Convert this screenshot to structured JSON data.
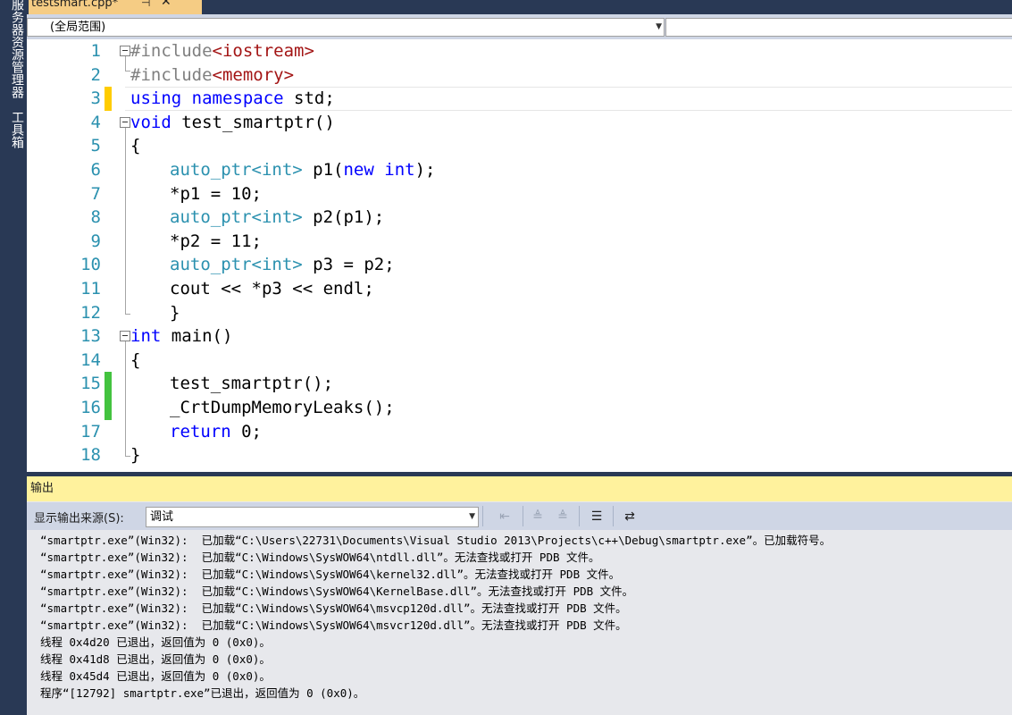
{
  "sidebar": {
    "tabs": [
      {
        "label": "服务器资源管理器"
      },
      {
        "label": "工具箱"
      }
    ]
  },
  "tab": {
    "title": "testsmart.cpp*",
    "pin_glyph": "⊣",
    "close_glyph": "✕"
  },
  "navbar": {
    "scope": "(全局范围)",
    "right": ""
  },
  "editor": {
    "lines": [
      {
        "n": "1"
      },
      {
        "n": "2"
      },
      {
        "n": "3"
      },
      {
        "n": "4"
      },
      {
        "n": "5"
      },
      {
        "n": "6"
      },
      {
        "n": "7"
      },
      {
        "n": "8"
      },
      {
        "n": "9"
      },
      {
        "n": "10"
      },
      {
        "n": "11"
      },
      {
        "n": "12"
      },
      {
        "n": "13"
      },
      {
        "n": "14"
      },
      {
        "n": "15"
      },
      {
        "n": "16"
      },
      {
        "n": "17"
      },
      {
        "n": "18"
      }
    ],
    "tokens": {
      "include": "#include",
      "iostream": "<iostream>",
      "memory": "<memory>",
      "using": "using",
      "namespace": "namespace",
      "std": " std;",
      "void": "void",
      "test_fn": " test_smartptr()",
      "lbrace": "{",
      "rbrace": "}",
      "auto_ptr": "auto_ptr",
      "int_tmpl": "<int>",
      "p1_decl": " p1(",
      "new": "new",
      "int": "int",
      "close_paren_semi": ");",
      "p1_assign": "*p1 = 10;",
      "p2_decl": " p2(p1);",
      "p2_assign": "*p2 = 11;",
      "p3_decl": " p3 = p2;",
      "cout": "cout << *p3 << endl;",
      "main": " main()",
      "call_test": "test_smartptr();",
      "call_dump": "_CrtDumpMemoryLeaks();",
      "return": "return",
      "ret_val": " 0;"
    }
  },
  "output": {
    "title": "输出",
    "source_label": "显示输出来源(S):",
    "source_value": "调试",
    "toolbar_icons": [
      "find-message-icon",
      "previous-message-icon",
      "next-message-icon",
      "clear-all-icon",
      "toggle-word-wrap-icon"
    ],
    "lines": [
      "“smartptr.exe”(Win32):  已加载“C:\\Users\\22731\\Documents\\Visual Studio 2013\\Projects\\c++\\Debug\\smartptr.exe”。已加载符号。",
      "“smartptr.exe”(Win32):  已加载“C:\\Windows\\SysWOW64\\ntdll.dll”。无法查找或打开 PDB 文件。",
      "“smartptr.exe”(Win32):  已加载“C:\\Windows\\SysWOW64\\kernel32.dll”。无法查找或打开 PDB 文件。",
      "“smartptr.exe”(Win32):  已加载“C:\\Windows\\SysWOW64\\KernelBase.dll”。无法查找或打开 PDB 文件。",
      "“smartptr.exe”(Win32):  已加载“C:\\Windows\\SysWOW64\\msvcp120d.dll”。无法查找或打开 PDB 文件。",
      "“smartptr.exe”(Win32):  已加载“C:\\Windows\\SysWOW64\\msvcr120d.dll”。无法查找或打开 PDB 文件。",
      "线程 0x4d20 已退出，返回值为 0 (0x0)。",
      "线程 0x41d8 已退出，返回值为 0 (0x0)。",
      "线程 0x45d4 已退出，返回值为 0 (0x0)。",
      "程序“[12792] smartptr.exe”已退出，返回值为 0 (0x0)。"
    ]
  }
}
